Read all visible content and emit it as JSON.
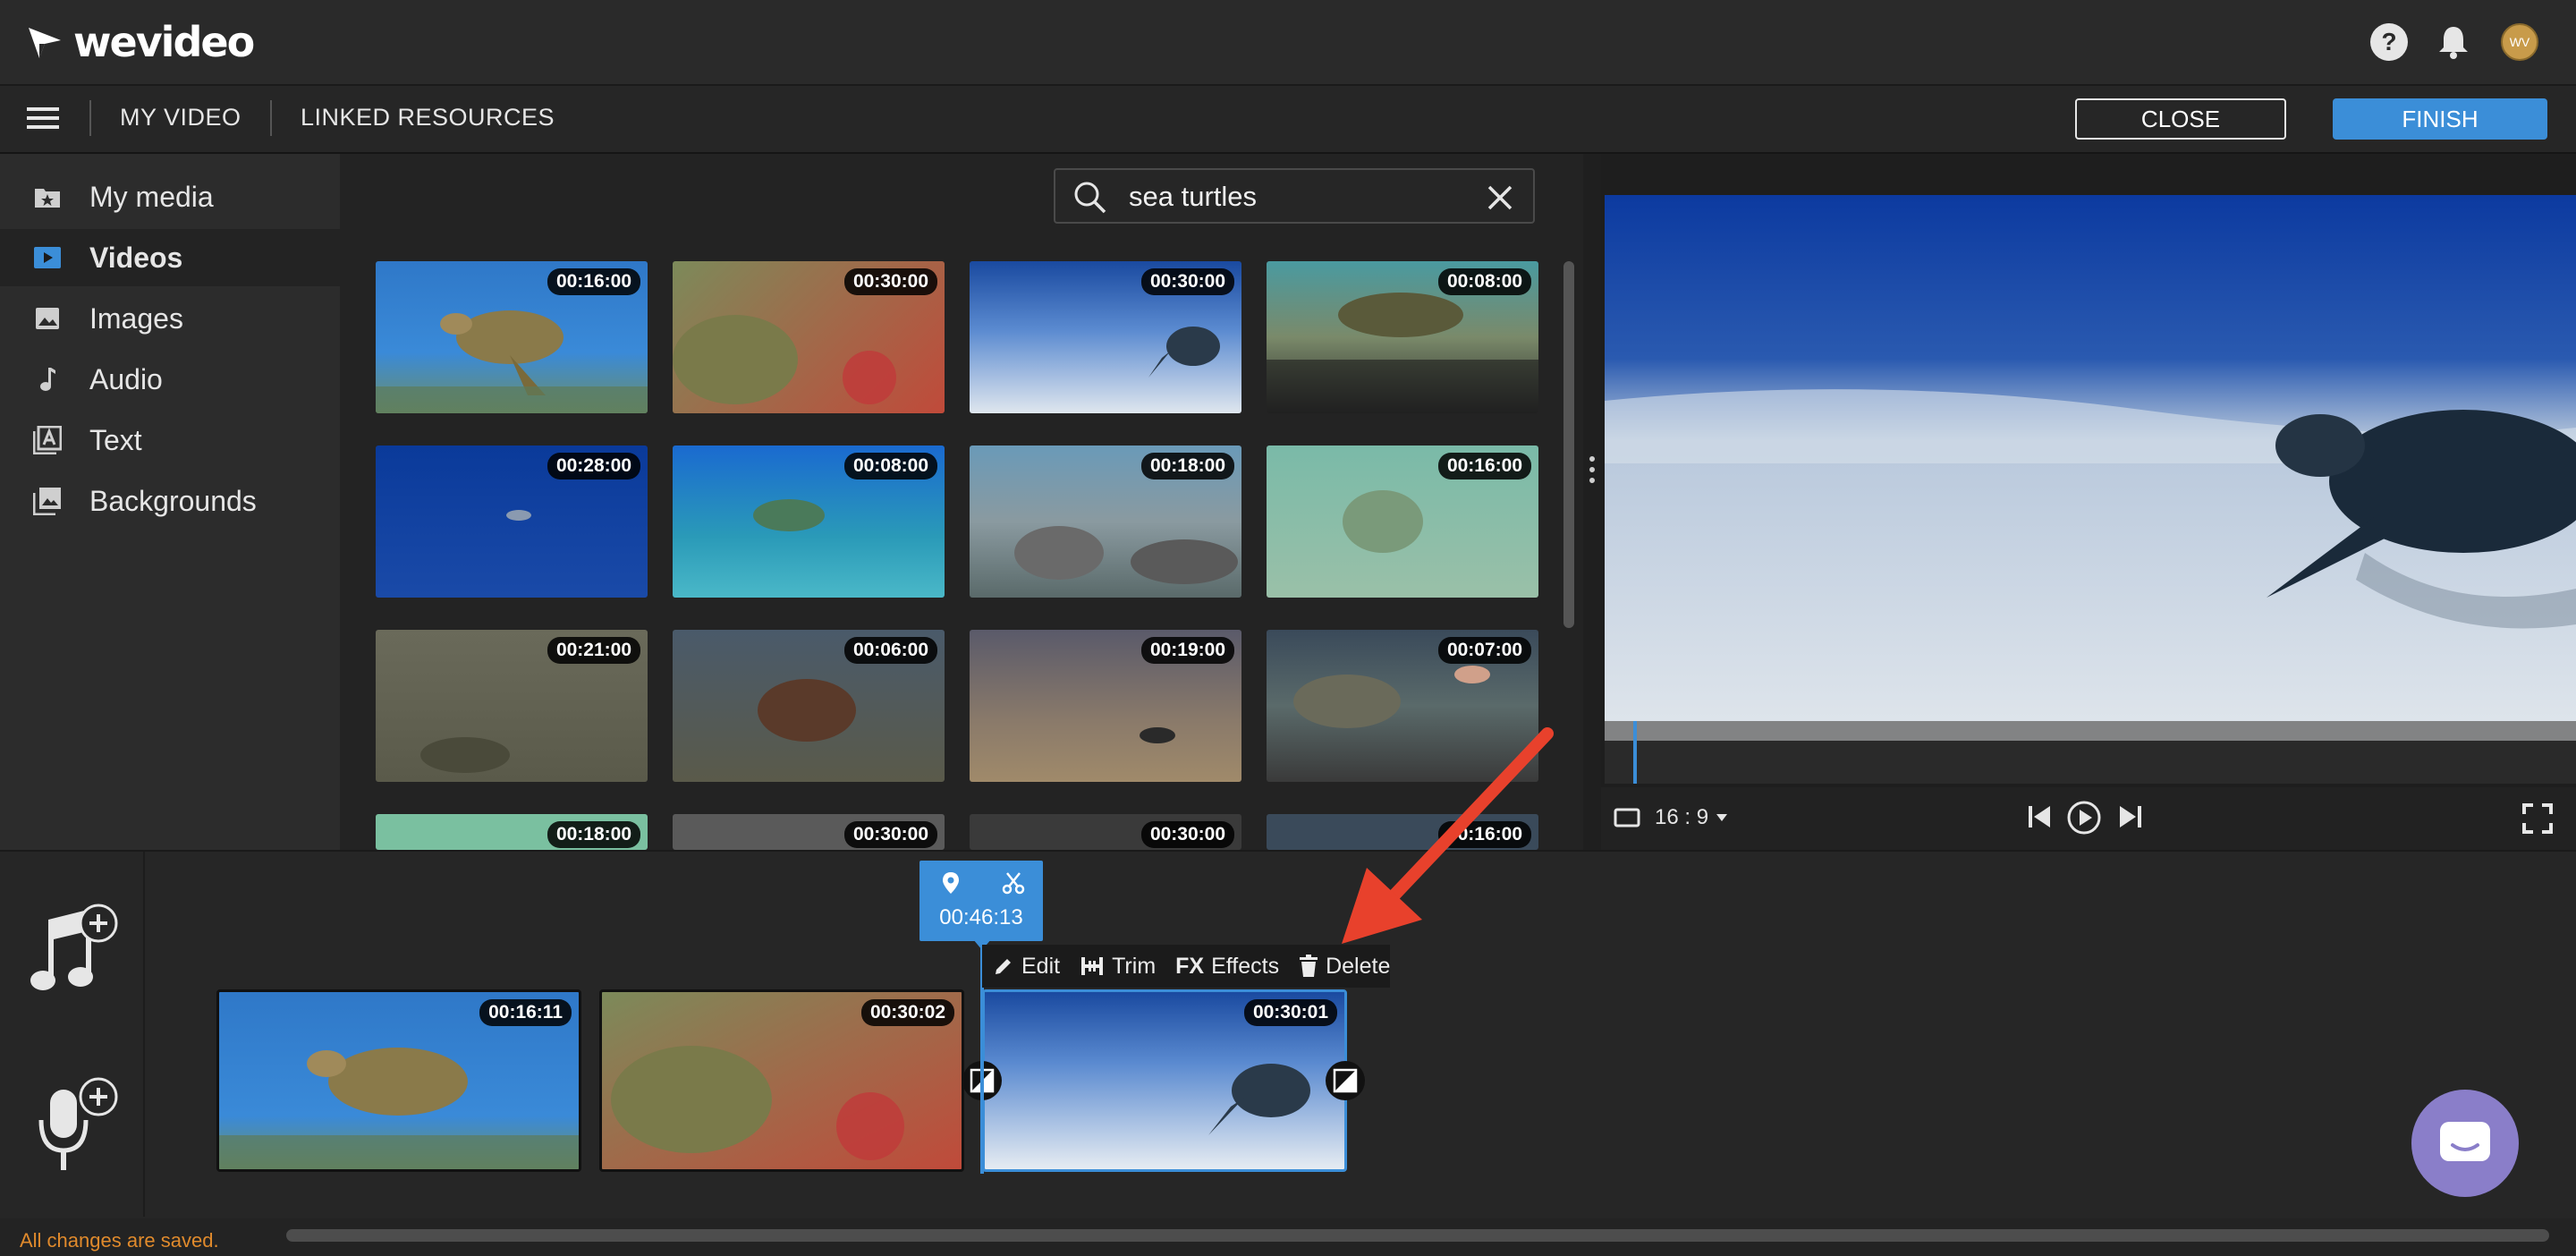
{
  "app": {
    "logo_text": "wevideo",
    "avatar_initials": "WV"
  },
  "nav": {
    "my_video": "MY VIDEO",
    "linked_resources": "LINKED RESOURCES",
    "close": "CLOSE",
    "finish": "FINISH"
  },
  "sidebar": {
    "items": [
      {
        "label": "My media",
        "icon": "star-folder-icon"
      },
      {
        "label": "Videos",
        "icon": "video-play-icon",
        "active": true
      },
      {
        "label": "Images",
        "icon": "image-icon"
      },
      {
        "label": "Audio",
        "icon": "music-note-icon"
      },
      {
        "label": "Text",
        "icon": "text-icon"
      },
      {
        "label": "Backgrounds",
        "icon": "backgrounds-icon"
      }
    ]
  },
  "search": {
    "value": "sea turtles",
    "placeholder": ""
  },
  "media": {
    "durations": [
      "00:16:00",
      "00:30:00",
      "00:30:00",
      "00:08:00",
      "00:28:00",
      "00:08:00",
      "00:18:00",
      "00:16:00",
      "00:21:00",
      "00:06:00",
      "00:19:00",
      "00:07:00",
      "00:18:00",
      "00:30:00",
      "00:30:00",
      "00:16:00"
    ]
  },
  "preview": {
    "aspect": "16 : 9"
  },
  "timeline": {
    "playhead_time": "00:46:13",
    "clip_menu": {
      "edit": "Edit",
      "trim": "Trim",
      "effects": "Effects",
      "delete": "Delete",
      "fx": "FX"
    },
    "clips": [
      "00:16:11",
      "00:30:02",
      "00:30:01"
    ]
  },
  "status": {
    "saved": "All changes are saved."
  },
  "colors": {
    "accent": "#3b8ed8",
    "arrow": "#e8412c",
    "saved_text": "#e08a2c",
    "chat": "#8a7ec9"
  }
}
